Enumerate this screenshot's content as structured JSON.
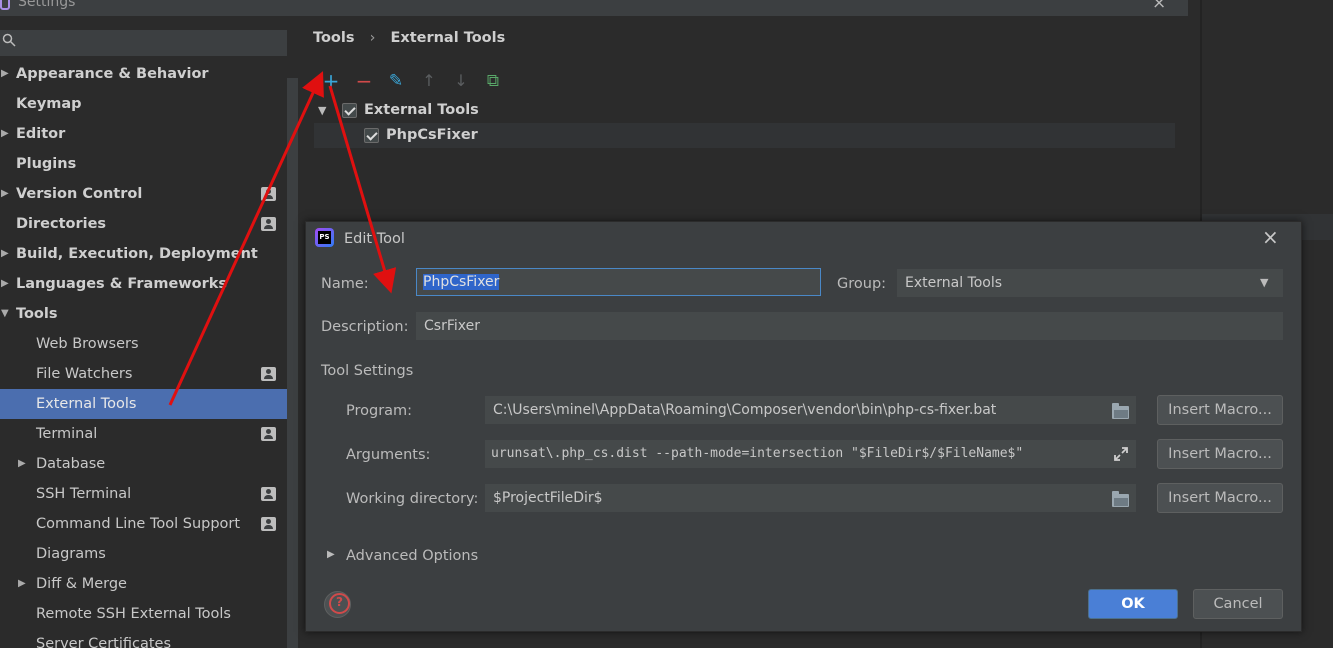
{
  "window": {
    "title": "Settings",
    "close_label": "×"
  },
  "search": {
    "placeholder": ""
  },
  "sidebar": {
    "items": [
      {
        "label": "Appearance & Behavior",
        "bold": true,
        "expandable": true,
        "badge": false
      },
      {
        "label": "Keymap",
        "bold": true,
        "expandable": false,
        "badge": false
      },
      {
        "label": "Editor",
        "bold": true,
        "expandable": true,
        "badge": false
      },
      {
        "label": "Plugins",
        "bold": true,
        "expandable": false,
        "badge": false
      },
      {
        "label": "Version Control",
        "bold": true,
        "expandable": true,
        "badge": true
      },
      {
        "label": "Directories",
        "bold": true,
        "expandable": false,
        "badge": true
      },
      {
        "label": "Build, Execution, Deployment",
        "bold": true,
        "expandable": true,
        "badge": false
      },
      {
        "label": "Languages & Frameworks",
        "bold": true,
        "expandable": true,
        "badge": false
      },
      {
        "label": "Tools",
        "bold": true,
        "expandable": true,
        "expanded": true,
        "badge": false
      },
      {
        "label": "Web Browsers",
        "sub": true,
        "badge": false
      },
      {
        "label": "File Watchers",
        "sub": true,
        "badge": true
      },
      {
        "label": "External Tools",
        "sub": true,
        "selected": true,
        "badge": false
      },
      {
        "label": "Terminal",
        "sub": true,
        "badge": true
      },
      {
        "label": "Database",
        "sub": true,
        "expandable": true,
        "badge": false
      },
      {
        "label": "SSH Terminal",
        "sub": true,
        "badge": true
      },
      {
        "label": "Command Line Tool Support",
        "sub": true,
        "badge": true
      },
      {
        "label": "Diagrams",
        "sub": true,
        "badge": false
      },
      {
        "label": "Diff & Merge",
        "sub": true,
        "expandable": true,
        "badge": false
      },
      {
        "label": "Remote SSH External Tools",
        "sub": true,
        "badge": false
      },
      {
        "label": "Server Certificates",
        "sub": true,
        "badge": false
      }
    ]
  },
  "breadcrumb": {
    "parent": "Tools",
    "separator": "›",
    "current": "External Tools"
  },
  "toolbar": {
    "add": "+",
    "remove": "−",
    "edit": "✎",
    "up": "↑",
    "down": "↓",
    "copy": "⧉"
  },
  "tree": {
    "group": {
      "label": "External Tools",
      "checked": true
    },
    "child": {
      "label": "PhpCsFixer",
      "checked": true
    }
  },
  "dialog": {
    "title": "Edit Tool",
    "close_label": "×",
    "name_label": "Name:",
    "name_value": "PhpCsFixer",
    "group_label": "Group:",
    "group_value": "External Tools",
    "description_label": "Description:",
    "description_value": "CsrFixer",
    "tool_settings_label": "Tool Settings",
    "program_label": "Program:",
    "program_value": "C:\\Users\\minel\\AppData\\Roaming\\Composer\\vendor\\bin\\php-cs-fixer.bat",
    "arguments_label": "Arguments:",
    "arguments_value": "urunsat\\.php_cs.dist --path-mode=intersection \"$FileDir$/$FileName$\"",
    "workdir_label": "Working directory:",
    "workdir_value": "$ProjectFileDir$",
    "insert_macro": "Insert Macro...",
    "advanced_label": "Advanced Options",
    "ok": "OK",
    "cancel": "Cancel"
  },
  "colors": {
    "selection": "#4b6eaf",
    "primary_button": "#4a7fd6",
    "annotation_arrow": "#e01010"
  }
}
